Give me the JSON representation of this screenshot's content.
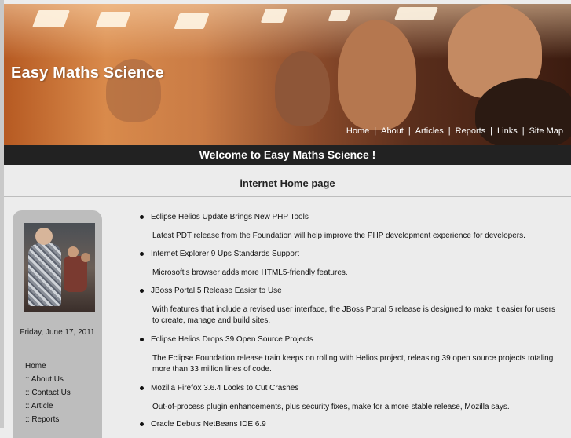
{
  "site": {
    "title": "Easy Maths Science"
  },
  "topnav": [
    "Home",
    "About",
    "Articles",
    "Reports",
    "Links",
    "Site Map"
  ],
  "welcome": "Welcome to Easy Maths Science !",
  "page_title": "internet Home page",
  "sidebar": {
    "date": "Friday, June 17, 2011",
    "nav": [
      ":: About Us",
      ":: Contact Us",
      ":: Article",
      ":: Reports"
    ],
    "home": "Home"
  },
  "news": [
    {
      "headline": "Eclipse Helios Update Brings New PHP Tools",
      "desc": "Latest PDT release from the Foundation will help improve the PHP development experience for developers."
    },
    {
      "headline": "Internet Explorer 9 Ups Standards Support",
      "desc": "Microsoft's browser adds more HTML5-friendly features."
    },
    {
      "headline": "JBoss Portal 5 Release Easier to Use",
      "desc": "With features that include a revised user interface, the JBoss Portal 5 release is designed to make it easier for users to create, manage and build sites."
    },
    {
      "headline": "Eclipse Helios Drops 39 Open Source Projects",
      "desc": "The Eclipse Foundation release train keeps on rolling with Helios project, releasing 39 open source projects totaling more than 33 million lines of code."
    },
    {
      "headline": "Mozilla Firefox 3.6.4 Looks to Cut Crashes",
      "desc": "Out-of-process plugin enhancements, plus security fixes, make for a more stable release, Mozilla says."
    },
    {
      "headline": "Oracle Debuts NetBeans IDE 6.9",
      "desc": ""
    }
  ]
}
